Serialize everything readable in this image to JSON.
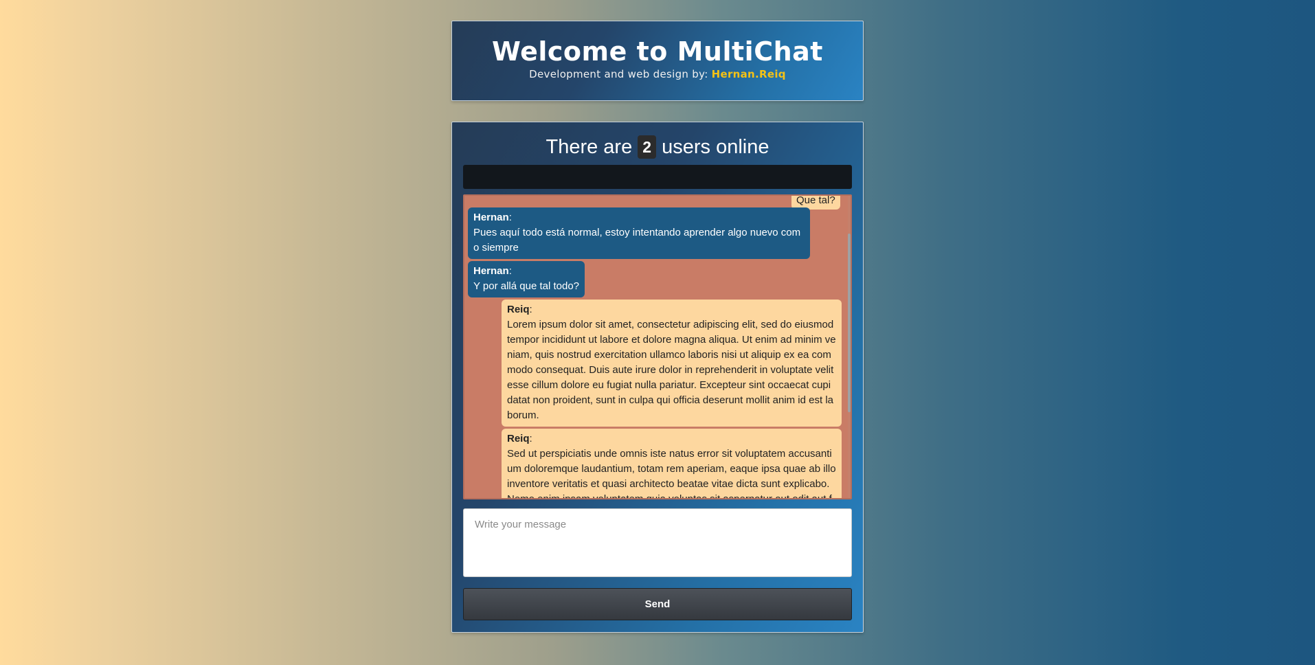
{
  "header": {
    "title": "Welcome to MultiChat",
    "subtitle_prefix": "Development and web design by: ",
    "author": "Hernan.Reiq"
  },
  "status": {
    "prefix": "There are",
    "online_count": "2",
    "suffix": "users online"
  },
  "messages": [
    {
      "user": "",
      "sep": "",
      "text": "Que tal?",
      "side": "theirs"
    },
    {
      "user": "Hernan",
      "sep": ":",
      "text": "Pues aquí todo está normal, estoy intentando aprender algo nuevo como siempre",
      "side": "mine"
    },
    {
      "user": "Hernan",
      "sep": ":",
      "text": "Y por allá que tal todo?",
      "side": "mine"
    },
    {
      "user": "Reiq",
      "sep": ":",
      "text": "Lorem ipsum dolor sit amet, consectetur adipiscing elit, sed do eiusmod tempor incididunt ut labore et dolore magna aliqua. Ut enim ad minim veniam, quis nostrud exercitation ullamco laboris nisi ut aliquip ex ea commodo consequat. Duis aute irure dolor in reprehenderit in voluptate velit esse cillum dolore eu fugiat nulla pariatur. Excepteur sint occaecat cupidatat non proident, sunt in culpa qui officia deserunt mollit anim id est laborum.",
      "side": "theirs"
    },
    {
      "user": "Reiq",
      "sep": ":",
      "text": "Sed ut perspiciatis unde omnis iste natus error sit voluptatem accusantium doloremque laudantium, totam rem aperiam, eaque ipsa quae ab illo inventore veritatis et quasi architecto beatae vitae dicta sunt explicabo. Nemo enim ipsam voluptatem quia voluptas sit aspernatur aut odit aut fugit",
      "side": "theirs"
    }
  ],
  "composer": {
    "placeholder": "Write your message",
    "send_label": "Send"
  },
  "colors": {
    "mine_bubble": "#1d5a84",
    "theirs_bubble": "#fdd79f",
    "messages_bg": "#c97c66",
    "author_accent": "#f4c216"
  }
}
